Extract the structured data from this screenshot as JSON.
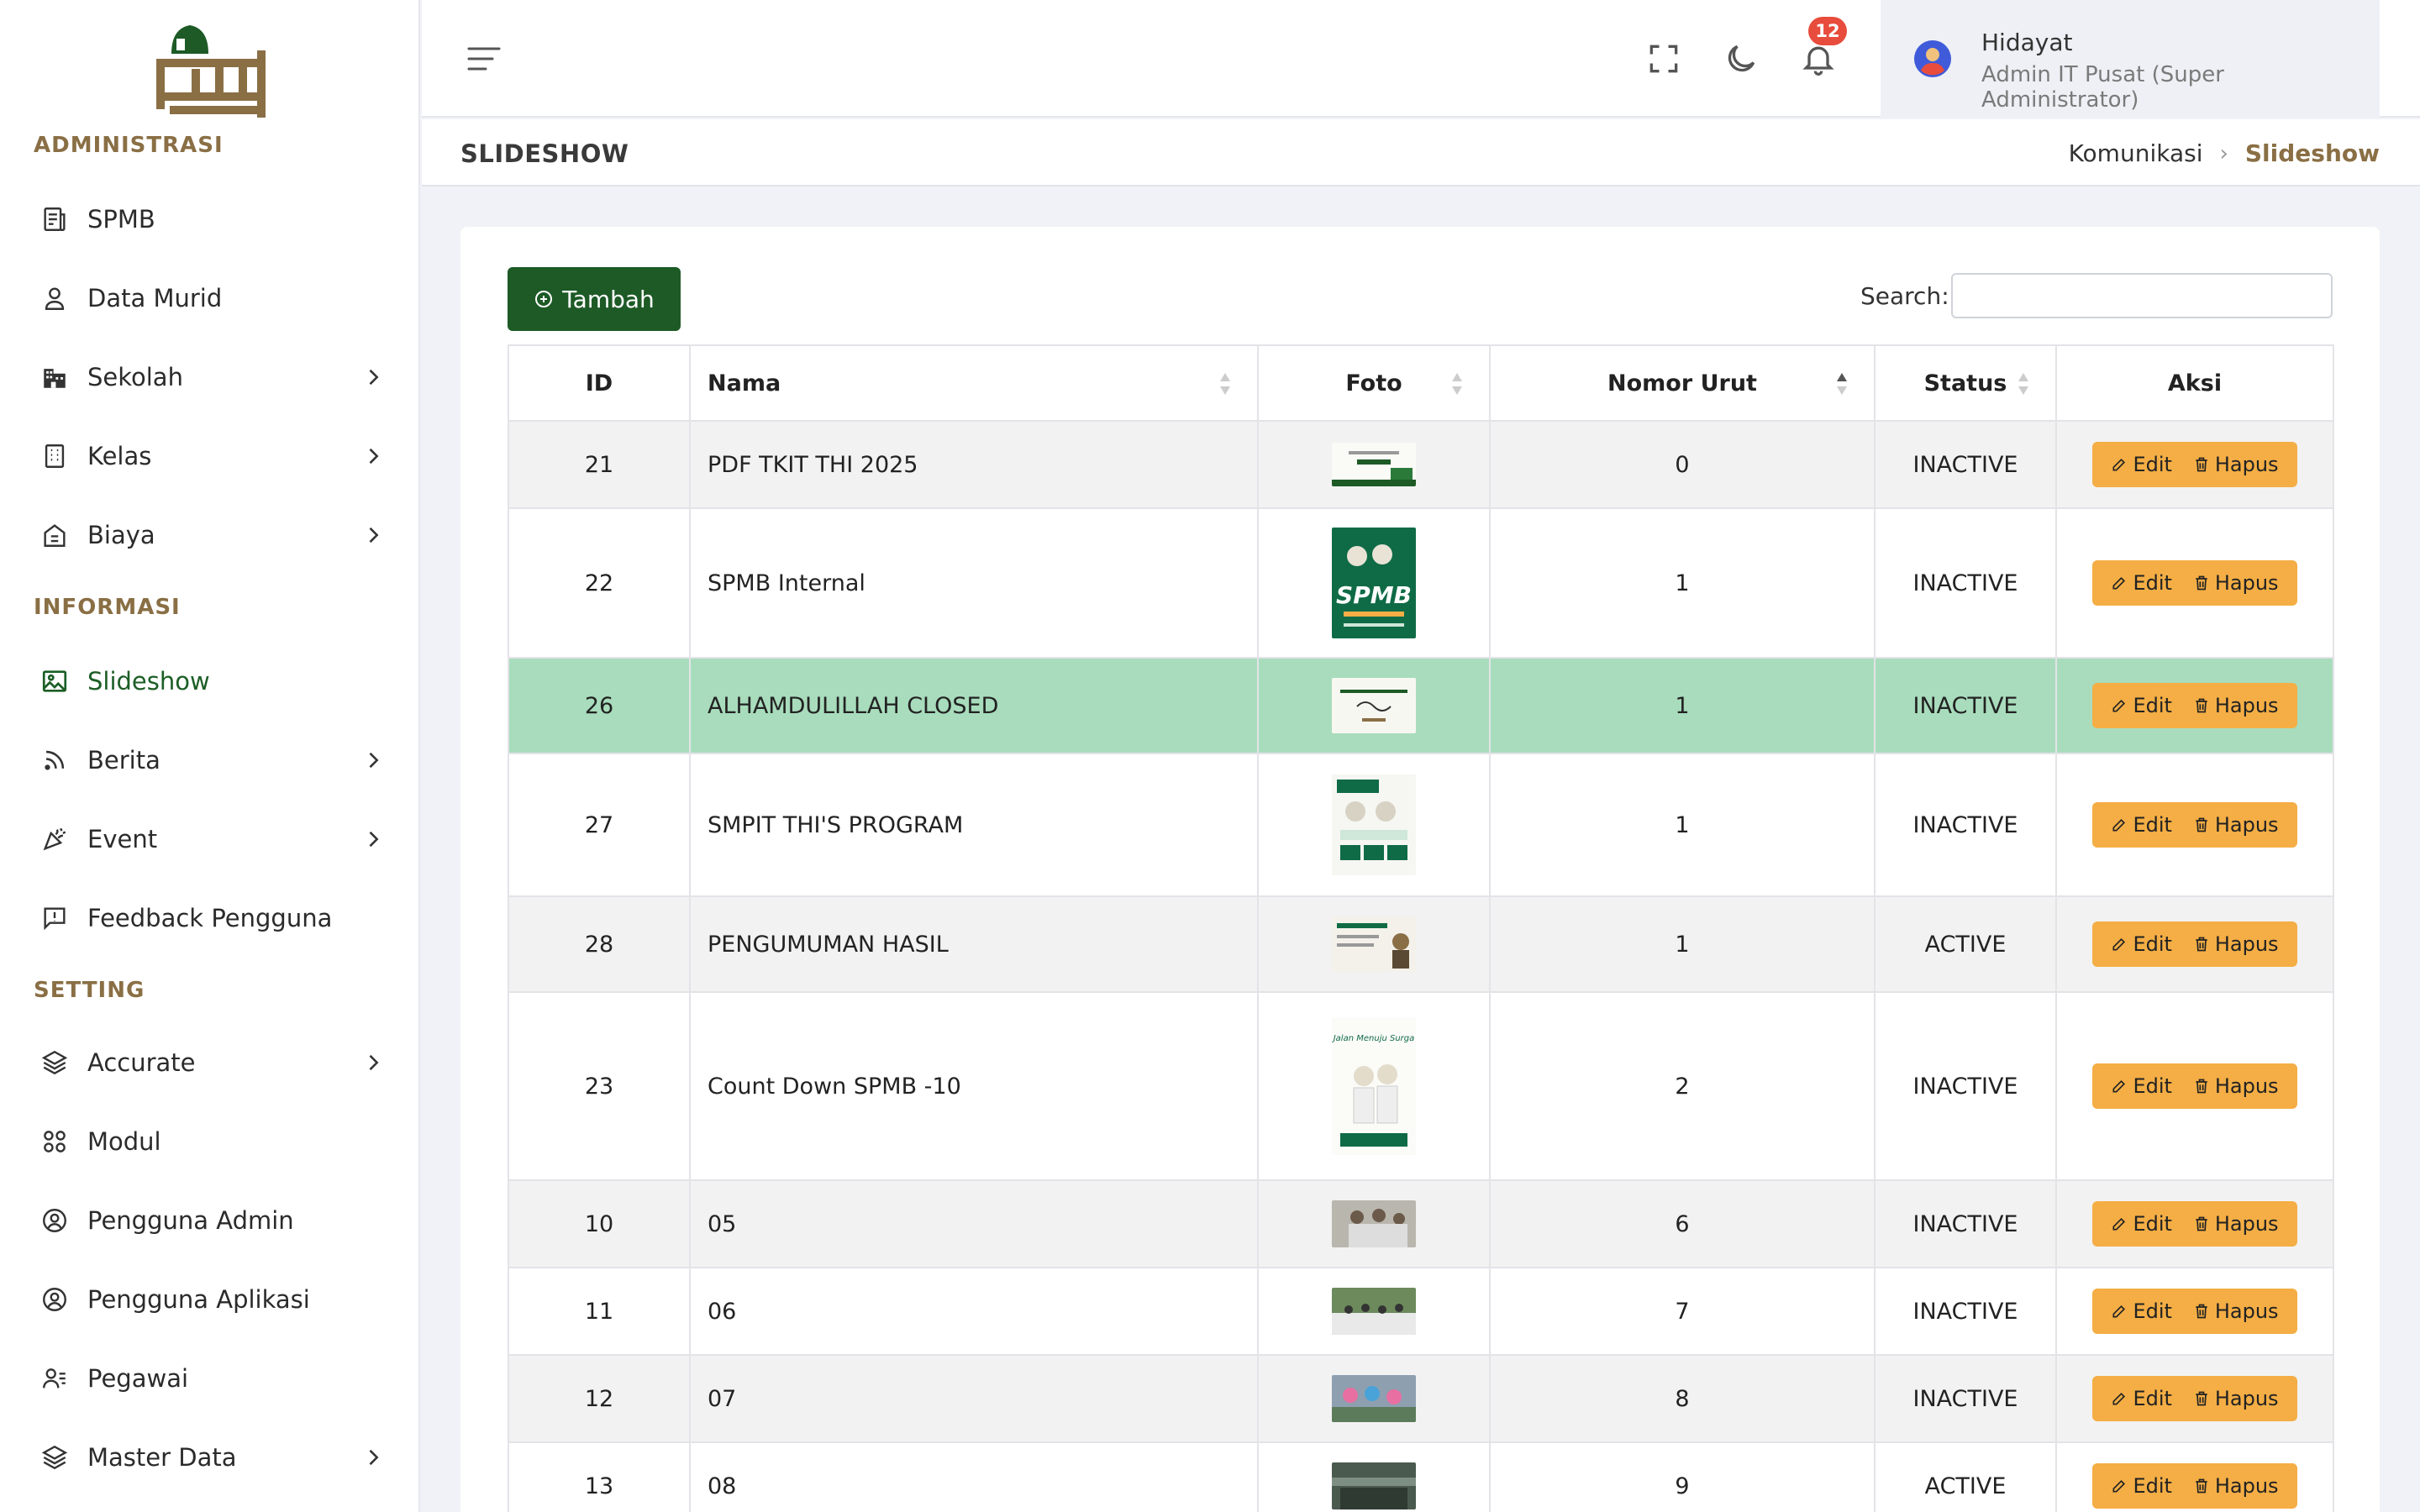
{
  "sidebar": {
    "section_admin": "ADMINISTRASI",
    "section_info": "INFORMASI",
    "section_setting": "SETTING",
    "items": [
      {
        "label": "SPMB",
        "icon": "document-icon",
        "chevron": false
      },
      {
        "label": "Data Murid",
        "icon": "user-icon",
        "chevron": false
      },
      {
        "label": "Sekolah",
        "icon": "building-icon",
        "chevron": true
      },
      {
        "label": "Kelas",
        "icon": "class-icon",
        "chevron": true
      },
      {
        "label": "Biaya",
        "icon": "fee-icon",
        "chevron": true
      },
      {
        "label": "Slideshow",
        "icon": "image-icon",
        "chevron": false,
        "active": true
      },
      {
        "label": "Berita",
        "icon": "rss-icon",
        "chevron": true
      },
      {
        "label": "Event",
        "icon": "party-icon",
        "chevron": true
      },
      {
        "label": "Feedback Pengguna",
        "icon": "feedback-icon",
        "chevron": false
      },
      {
        "label": "Accurate",
        "icon": "layers-icon",
        "chevron": true
      },
      {
        "label": "Modul",
        "icon": "modules-icon",
        "chevron": false
      },
      {
        "label": "Pengguna Admin",
        "icon": "user-circle-icon",
        "chevron": false
      },
      {
        "label": "Pengguna Aplikasi",
        "icon": "user-circle-icon",
        "chevron": false
      },
      {
        "label": "Pegawai",
        "icon": "employee-icon",
        "chevron": false
      },
      {
        "label": "Master Data",
        "icon": "layers-icon",
        "chevron": true
      }
    ]
  },
  "header": {
    "notification_count": "12",
    "user_name": "Hidayat",
    "user_role": "Admin IT Pusat (Super Administrator)"
  },
  "page": {
    "title": "SLIDESHOW",
    "breadcrumb_parent": "Komunikasi",
    "breadcrumb_current": "Slideshow"
  },
  "toolbar": {
    "add_label": "Tambah",
    "search_label": "Search:",
    "search_value": ""
  },
  "table": {
    "columns": [
      "ID",
      "Nama",
      "Foto",
      "Nomor Urut",
      "Status",
      "Aksi"
    ],
    "edit_label": "Edit",
    "delete_label": "Hapus",
    "rows": [
      {
        "id": "21",
        "nama": "PDF TKIT THI 2025",
        "urut": "0",
        "status": "INACTIVE",
        "thumb": "wide"
      },
      {
        "id": "22",
        "nama": "SPMB Internal",
        "urut": "1",
        "status": "INACTIVE",
        "thumb": "poster-green"
      },
      {
        "id": "26",
        "nama": "ALHAMDULILLAH CLOSED",
        "urut": "1",
        "status": "INACTIVE",
        "thumb": "wide-light",
        "highlight": true
      },
      {
        "id": "27",
        "nama": "SMPIT THI'S PROGRAM",
        "urut": "1",
        "status": "INACTIVE",
        "thumb": "poster-white"
      },
      {
        "id": "28",
        "nama": "PENGUMUMAN HASIL",
        "urut": "1",
        "status": "ACTIVE",
        "thumb": "wide-mixed"
      },
      {
        "id": "23",
        "nama": "Count Down SPMB -10",
        "urut": "2",
        "status": "INACTIVE",
        "thumb": "poster-tall"
      },
      {
        "id": "10",
        "nama": "05",
        "urut": "6",
        "status": "INACTIVE",
        "thumb": "photo-grey"
      },
      {
        "id": "11",
        "nama": "06",
        "urut": "7",
        "status": "INACTIVE",
        "thumb": "photo-green"
      },
      {
        "id": "12",
        "nama": "07",
        "urut": "8",
        "status": "INACTIVE",
        "thumb": "photo-blue"
      },
      {
        "id": "13",
        "nama": "08",
        "urut": "9",
        "status": "ACTIVE",
        "thumb": "photo-dark"
      }
    ]
  },
  "colors": {
    "brand_green": "#1d5a26",
    "brand_gold": "#8a6f45",
    "action_orange": "#f4ae45",
    "highlight_row": "#a8dcbc",
    "badge_red": "#e74c3c"
  }
}
